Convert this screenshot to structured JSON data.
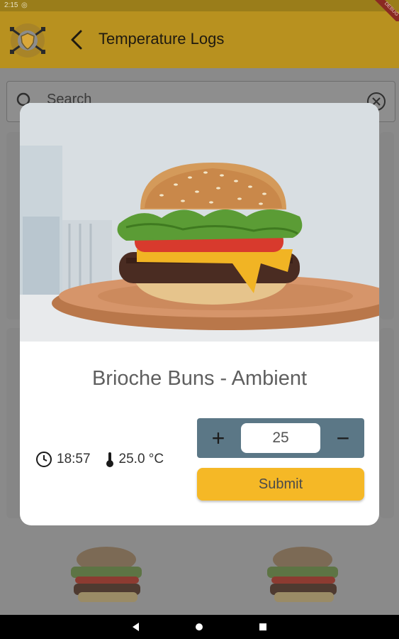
{
  "status_bar": {
    "time": "2:15",
    "icon": "settings-dot-icon"
  },
  "app_bar": {
    "title": "Temperature Logs",
    "back_icon": "chevron-left-icon",
    "logo_icon": "shield-logo-icon",
    "debug_banner": "DEBUG"
  },
  "search": {
    "placeholder": "Search",
    "icon": "search-icon",
    "clear_icon": "clear-circle-icon"
  },
  "modal": {
    "title": "Brioche Buns - Ambient",
    "time": "18:57",
    "temperature": "25.0 °C",
    "stepper_value": "25",
    "plus_label": "+",
    "minus_label": "−",
    "submit_label": "Submit"
  },
  "nav_bar": {
    "back": "nav-back-icon",
    "home": "nav-home-icon",
    "recents": "nav-recents-icon"
  },
  "colors": {
    "accent": "#f5b826",
    "app_bar": "#b8911f",
    "stepper": "#5b7786"
  }
}
